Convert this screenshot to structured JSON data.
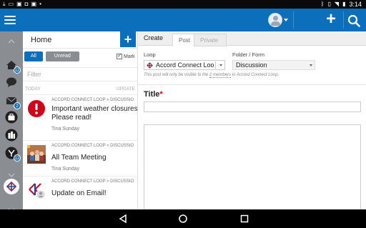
{
  "status_bar": {
    "left_icons": [
      "download-icon",
      "chat-icon",
      "shopping-bag-icon",
      "lock-icon",
      "shopping-bag-icon",
      "notification-dot-icon"
    ],
    "right_icons": [
      "bluetooth-icon",
      "vibrate-icon",
      "wifi-icon",
      "battery-icon"
    ],
    "time": "3:14"
  },
  "app_bar": {
    "menu_icon": "hamburger-icon",
    "avatar_icon": "user-avatar-icon",
    "new_icon": "plus-icon",
    "search_icon": "search-icon",
    "color": "#0b6fbb"
  },
  "rail": {
    "items": [
      {
        "icon": "home-icon",
        "badge": "12"
      },
      {
        "icon": "chat-bubble-icon",
        "badge": ""
      },
      {
        "icon": "mail-icon",
        "badge": "2"
      },
      {
        "icon": "briefcase-icon",
        "badge": ""
      },
      {
        "icon": "buildings-icon",
        "badge": ""
      },
      {
        "icon": "network-icon",
        "badge": "12"
      }
    ]
  },
  "feed": {
    "title": "Home",
    "add_label": "+",
    "filters": {
      "all": "All",
      "unread": "Unread",
      "mark": "Mark"
    },
    "filter_placeholder": "Filter",
    "date_left": "TODAY",
    "date_right": "UPDATE",
    "posts": [
      {
        "crumb": "ACCORD CONNECT LOOP » DISCUSSIO",
        "title_line1": "Important weather closures",
        "title_line2": "Please read!",
        "author": "Tina Sunday",
        "thumb": "alert-icon"
      },
      {
        "crumb": "ACCORD CONNECT LOOP » DISCUSSIO",
        "title_line1": "All Team Meeting",
        "title_line2": "",
        "author": "Tina Sunday",
        "thumb": "meeting-photo"
      },
      {
        "crumb": "ACCORD CONNECT LOOP » DISCUSSIO",
        "title_line1": "Update on Email!",
        "title_line2": "",
        "author": "",
        "thumb": "accord-logo-avatar"
      }
    ]
  },
  "create": {
    "header": "Create",
    "tabs": {
      "post": "Post",
      "private": "Private"
    },
    "loop_label": "Loop",
    "loop_value": "Accord Connect Loo",
    "folder_label": "Folder / Form",
    "folder_value": "Discussion",
    "visibility_pre": "This post will only be visible to the ",
    "visibility_link": "2 members",
    "visibility_post": " in Accord Connect Loop.",
    "title_label": "Title",
    "required_mark": "*"
  },
  "nav_bar": {
    "back": "back-triangle-icon",
    "home": "home-circle-icon",
    "recents": "recents-square-icon"
  }
}
